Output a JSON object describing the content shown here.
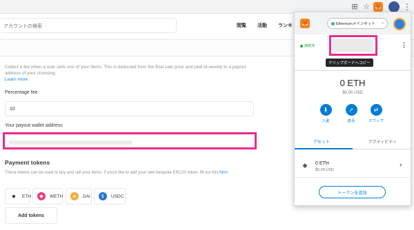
{
  "browser": {
    "icons": [
      "translate-icon",
      "star-icon",
      "metamask-fox-icon",
      "puzzle-icon"
    ],
    "menu_glyph": "⋮"
  },
  "header": {
    "search_placeholder": "アカウントの検索",
    "nav": [
      "閲覧",
      "活動",
      "ランキ"
    ]
  },
  "form": {
    "fee_description": "Collect a fee when a user sells one of your items. This is deducted from the final sale price and paid bi-weekly to a payout address of your choosing.",
    "learn_more": "Learn more",
    "percentage_fee_label": "Percentage fee",
    "percentage_fee_value": "10",
    "payout_label": "Your payout wallet address",
    "payment_tokens_title": "Payment tokens",
    "payment_tokens_desc": "These tokens can be used to buy and sell your items. If you'd like to add your own bespoke ERC20 token, fill out this",
    "payment_tokens_link": "form",
    "tokens": [
      {
        "label": "ETH",
        "icon": "eth-icon",
        "glyph": "◆",
        "color": "#ffffff"
      },
      {
        "label": "WETH",
        "icon": "weth-icon",
        "glyph": "◆",
        "color": "#ec407a"
      },
      {
        "label": "DAI",
        "icon": "dai-icon",
        "glyph": "◈",
        "color": "#f5ac37"
      },
      {
        "label": "USDC",
        "icon": "usdc-icon",
        "glyph": "$",
        "color": "#2775ca"
      }
    ],
    "add_tokens_label": "Add tokens"
  },
  "metamask": {
    "network": "Ethereumメインネット",
    "connected": "接続済",
    "tooltip": "クリップボードへコピー",
    "balance": "0 ETH",
    "balance_usd": "$0.00 USD",
    "actions": [
      "入金",
      "送る",
      "スワップ"
    ],
    "tabs": [
      "アセット",
      "アクティビティ"
    ],
    "asset_name": "0 ETH",
    "asset_usd": "$0.00 USD",
    "add_token": "トークンを追加"
  },
  "colors": {
    "highlight": "#ea2c8e",
    "metamask_blue": "#037dd6",
    "opensea_blue": "#2081e2"
  }
}
